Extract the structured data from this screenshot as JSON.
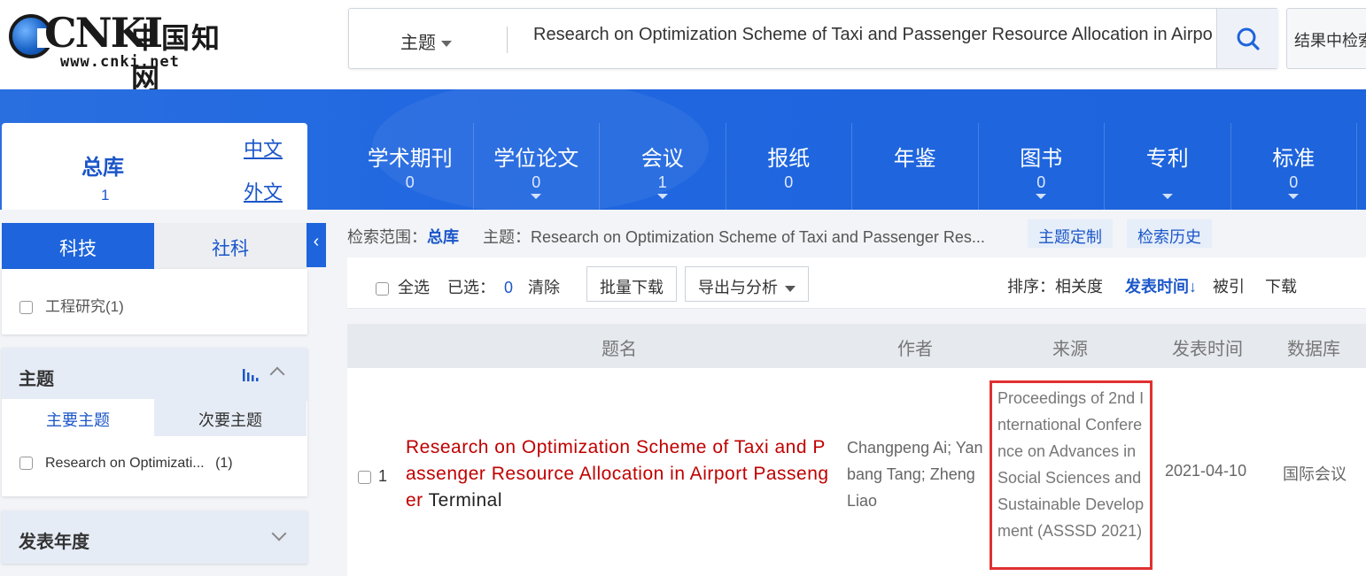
{
  "header": {
    "logo_text": "CNKI",
    "logo_cn": "中国知网",
    "logo_url": "www.cnki.net",
    "search_type": "主题",
    "search_value": "Research on Optimization Scheme of Taxi and Passenger Resource Allocation in Airport Passenger Terminal",
    "result_search_label": "结果中检索"
  },
  "databases": {
    "total_label": "总库",
    "total_count": "1",
    "chinese_label": "中文",
    "foreign_label": "外文",
    "tabs": [
      {
        "label": "学术期刊",
        "count": "0",
        "has_dropdown": false
      },
      {
        "label": "学位论文",
        "count": "0",
        "has_dropdown": true
      },
      {
        "label": "会议",
        "count": "1",
        "has_dropdown": true
      },
      {
        "label": "报纸",
        "count": "0",
        "has_dropdown": false
      },
      {
        "label": "年鉴",
        "count": "",
        "has_dropdown": false
      },
      {
        "label": "图书",
        "count": "0",
        "has_dropdown": true
      },
      {
        "label": "专利",
        "count": "",
        "has_dropdown": true
      },
      {
        "label": "标准",
        "count": "0",
        "has_dropdown": true
      }
    ]
  },
  "sidebar": {
    "tab_science": "科技",
    "tab_social": "社科",
    "collapse_glyph": "‹",
    "categories": [
      {
        "label": "工程研究(1)"
      }
    ],
    "topic_title": "主题",
    "topic_tab_main": "主要主题",
    "topic_tab_secondary": "次要主题",
    "topic_items": [
      {
        "label": "Research on Optimizati...",
        "count": "(1)"
      }
    ],
    "year_title": "发表年度"
  },
  "scope": {
    "label": "检索范围：",
    "value": "总库",
    "topic": "主题：Research on Optimization Scheme of Taxi and Passenger Res...",
    "customize_btn": "主题定制",
    "history_btn": "检索历史"
  },
  "toolbar": {
    "select_all": "全选",
    "selected_label": "已选：",
    "selected_count": "0",
    "clear": "清除",
    "batch_download": "批量下载",
    "export_analyze": "导出与分析",
    "sort_label": "排序：",
    "sort_relevance": "相关度",
    "sort_date": "发表时间",
    "sort_date_arrow": "↓",
    "sort_cited": "被引",
    "sort_download": "下载"
  },
  "table": {
    "headers": {
      "title": "题名",
      "author": "作者",
      "source": "来源",
      "date": "发表时间",
      "database": "数据库"
    },
    "rows": [
      {
        "index": "1",
        "title_highlight": "Research on Optimization Scheme of Taxi and Passenger Resource Allocation in Airport Passenger",
        "title_rest": " Terminal",
        "authors": "Changpeng Ai; Yanbang Tang; Zheng Liao",
        "source": "Proceedings of 2nd International Conference on Advances in Social Sciences and Sustainable Development (ASSSD 2021)",
        "date": "2021-04-10",
        "database": "国际会议"
      }
    ]
  },
  "colors": {
    "brand_blue": "#1e64dc",
    "link_blue": "#1b56c9",
    "highlight_red": "#c00000",
    "source_box_red": "#e03030"
  }
}
